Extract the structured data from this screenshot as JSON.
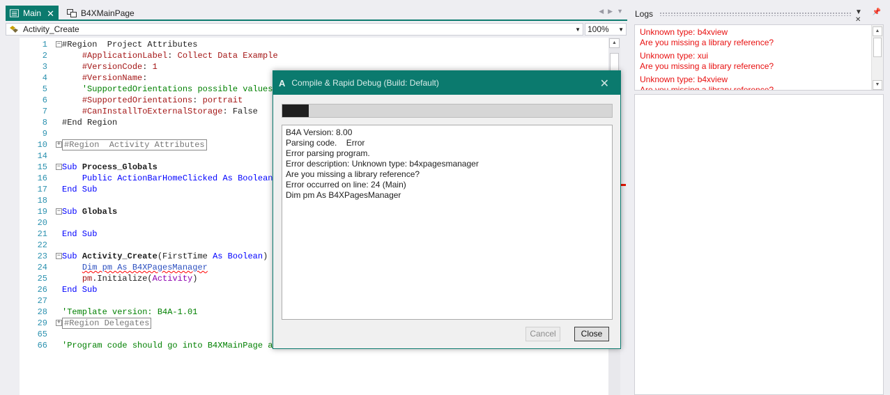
{
  "tabs": [
    {
      "label": "Main",
      "active": true
    },
    {
      "label": "B4XMainPage",
      "active": false
    }
  ],
  "module_combo": {
    "value": "Activity_Create"
  },
  "zoom_combo": {
    "value": "100%"
  },
  "code_lines": [
    {
      "n": "1",
      "fold": "minus",
      "parts": [
        [
          "t",
          "#Region  Project Attributes"
        ]
      ]
    },
    {
      "n": "2",
      "parts": [
        [
          "t",
          "    "
        ],
        [
          "dir",
          "#ApplicationLabel"
        ],
        [
          "t",
          ": "
        ],
        [
          "dir",
          "Collect Data Example"
        ]
      ]
    },
    {
      "n": "3",
      "parts": [
        [
          "t",
          "    "
        ],
        [
          "dir",
          "#VersionCode"
        ],
        [
          "t",
          ": "
        ],
        [
          "dir",
          "1"
        ]
      ]
    },
    {
      "n": "4",
      "parts": [
        [
          "t",
          "    "
        ],
        [
          "dir",
          "#VersionName"
        ],
        [
          "t",
          ":"
        ]
      ]
    },
    {
      "n": "5",
      "parts": [
        [
          "t",
          "    "
        ],
        [
          "cm",
          "'SupportedOrientations possible values:"
        ]
      ]
    },
    {
      "n": "6",
      "parts": [
        [
          "t",
          "    "
        ],
        [
          "dir",
          "#SupportedOrientations"
        ],
        [
          "t",
          ": "
        ],
        [
          "dir",
          "portrait"
        ]
      ]
    },
    {
      "n": "7",
      "parts": [
        [
          "t",
          "    "
        ],
        [
          "dir",
          "#CanInstallToExternalStorage"
        ],
        [
          "t",
          ": "
        ],
        [
          "t",
          "False"
        ]
      ]
    },
    {
      "n": "8",
      "parts": [
        [
          "t",
          "#End Region"
        ]
      ]
    },
    {
      "n": "9",
      "parts": []
    },
    {
      "n": "10",
      "fold": "plus",
      "parts": [
        [
          "box",
          "#Region  Activity Attributes"
        ]
      ]
    },
    {
      "n": "14",
      "parts": []
    },
    {
      "n": "15",
      "fold": "minus",
      "parts": [
        [
          "kw",
          "Sub "
        ],
        [
          "b",
          "Process_Globals"
        ]
      ]
    },
    {
      "n": "16",
      "parts": [
        [
          "t",
          "    "
        ],
        [
          "kw",
          "Public "
        ],
        [
          "kw",
          "ActionBarHomeClicked "
        ],
        [
          "kw",
          "As Boolean"
        ]
      ]
    },
    {
      "n": "17",
      "parts": [
        [
          "kw",
          "End Sub"
        ]
      ]
    },
    {
      "n": "18",
      "parts": []
    },
    {
      "n": "19",
      "fold": "minus",
      "parts": [
        [
          "kw",
          "Sub "
        ],
        [
          "b",
          "Globals"
        ]
      ]
    },
    {
      "n": "20",
      "parts": []
    },
    {
      "n": "21",
      "parts": [
        [
          "kw",
          "End Sub"
        ]
      ]
    },
    {
      "n": "22",
      "parts": []
    },
    {
      "n": "23",
      "fold": "minus",
      "parts": [
        [
          "kw",
          "Sub "
        ],
        [
          "b",
          "Activity_Create"
        ],
        [
          "t",
          "(FirstTime "
        ],
        [
          "kw",
          "As Boolean"
        ],
        [
          "t",
          ")"
        ]
      ]
    },
    {
      "n": "24",
      "parts": [
        [
          "t",
          "    "
        ],
        [
          "sq",
          "Dim pm As B4XPagesManager"
        ]
      ]
    },
    {
      "n": "25",
      "parts": [
        [
          "t",
          "    "
        ],
        [
          "dir",
          "pm"
        ],
        [
          "t",
          ".Initialize("
        ],
        [
          "kwp",
          "Activity"
        ],
        [
          "t",
          ")"
        ]
      ]
    },
    {
      "n": "26",
      "parts": [
        [
          "kw",
          "End Sub"
        ]
      ]
    },
    {
      "n": "27",
      "parts": []
    },
    {
      "n": "28",
      "parts": [
        [
          "cm",
          "'Template version: B4A-1.01"
        ]
      ]
    },
    {
      "n": "29",
      "fold": "plus",
      "parts": [
        [
          "box",
          "#Region Delegates"
        ]
      ]
    },
    {
      "n": "65",
      "parts": []
    },
    {
      "n": "66",
      "parts": [
        [
          "cm",
          "'Program code should go into B4XMainPage an"
        ]
      ]
    }
  ],
  "logs": {
    "title": "Logs",
    "entries": [
      "Unknown type: b4xview",
      "Are you missing a library reference?",
      "Unknown type: xui",
      "Are you missing a library reference?",
      "Unknown type: b4xview",
      "Are you missing a library reference?"
    ]
  },
  "dialog": {
    "logo": "A",
    "title": "Compile & Rapid Debug (Build: Default)",
    "progress_fraction": 0.08,
    "output_lines": [
      "B4A Version: 8.00",
      "Parsing code.    Error",
      "Error parsing program.",
      "Error description: Unknown type: b4xpagesmanager",
      "Are you missing a library reference?",
      "Error occurred on line: 24 (Main)",
      "Dim pm As B4XPagesManager"
    ],
    "cancel_label": "Cancel",
    "close_label": "Close"
  },
  "colors": {
    "accent": "#0b7a6e",
    "error": "#e81010"
  }
}
